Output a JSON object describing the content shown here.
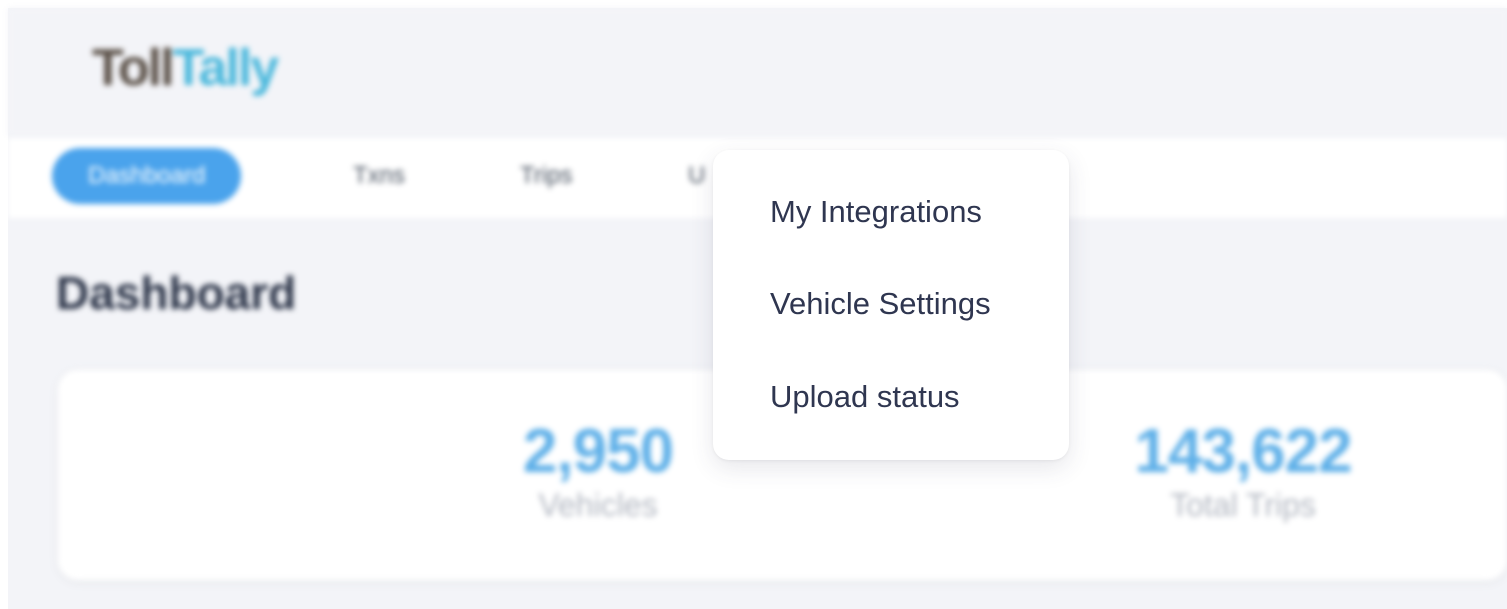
{
  "header": {
    "logo": {
      "part1": "Toll",
      "part2": "Tally"
    }
  },
  "nav": {
    "tabs": [
      {
        "label": "Dashboard",
        "active": true
      },
      {
        "label": "Txns"
      },
      {
        "label": "Trips"
      },
      {
        "label": "U"
      }
    ]
  },
  "main": {
    "title": "Dashboard",
    "stats": [
      {
        "value": "2,950",
        "label": "Vehicles"
      },
      {
        "value": "143,622",
        "label": "Total Trips"
      }
    ]
  },
  "dropdown": {
    "items": [
      {
        "label": "My Integrations"
      },
      {
        "label": "Vehicle Settings"
      },
      {
        "label": "Upload status"
      }
    ]
  },
  "colors": {
    "accent": "#4aa3ec",
    "stat_value": "#5fb0e8",
    "logo_tally": "#4ab8dc",
    "background": "#f3f4f8"
  }
}
